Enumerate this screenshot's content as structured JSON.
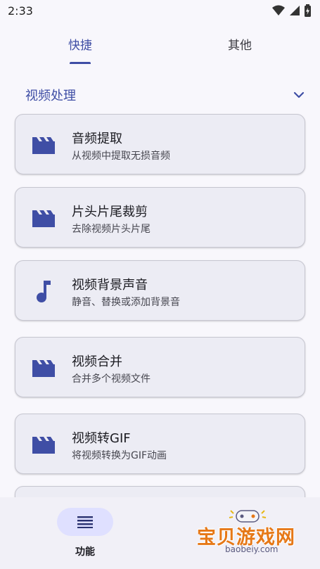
{
  "status": {
    "time": "2:33"
  },
  "tabs": [
    {
      "label": "快捷",
      "active": true
    },
    {
      "label": "其他",
      "active": false
    }
  ],
  "section": {
    "title": "视频处理"
  },
  "items": [
    {
      "title": "音频提取",
      "subtitle": "从视频中提取无损音频",
      "icon": "movie-clapper-icon"
    },
    {
      "title": "片头片尾裁剪",
      "subtitle": "去除视频片头片尾",
      "icon": "movie-clapper-icon"
    },
    {
      "title": "视频背景声音",
      "subtitle": "静音、替换或添加背景音",
      "icon": "music-note-icon"
    },
    {
      "title": "视频合并",
      "subtitle": "合并多个视频文件",
      "icon": "movie-clapper-icon"
    },
    {
      "title": "视频转GIF",
      "subtitle": "将视频转换为GIF动画",
      "icon": "movie-clapper-icon"
    }
  ],
  "bottom_nav": [
    {
      "label": "功能",
      "icon": "menu-lines-icon",
      "active": true
    }
  ],
  "watermark": {
    "text": "宝贝游戏网",
    "url": "baobeiy.com"
  },
  "colors": {
    "accent": "#3f4ea5",
    "card": "#ececf4",
    "pill": "#dfe0ff",
    "watermark": "#e67817"
  }
}
